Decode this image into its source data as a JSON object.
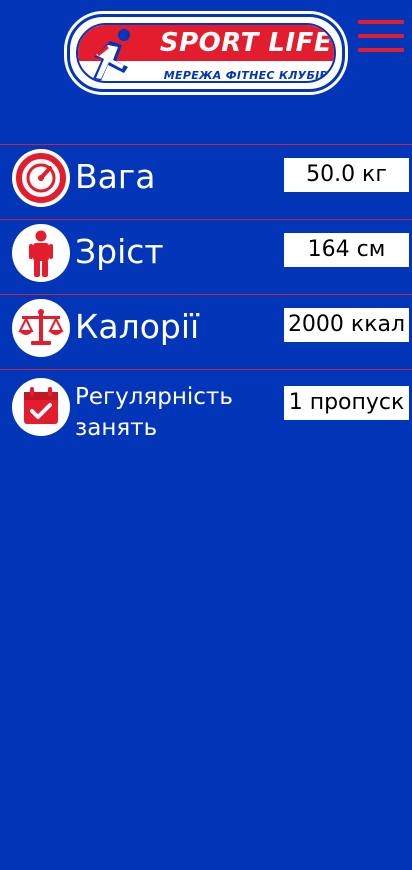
{
  "header": {
    "logo_title": "SPORT LIFE",
    "logo_subtitle": "МЕРЕЖА ФІТНЕС КЛУБІВ",
    "menu_icon": "hamburger-icon"
  },
  "colors": {
    "background": "#0235b8",
    "accent_red": "#e31d2d",
    "divider": "#c7243d"
  },
  "metrics": [
    {
      "label": "Вага",
      "value": "50.0 кг",
      "icon": "speedometer-icon"
    },
    {
      "label": "Зріст",
      "value": "164 см",
      "icon": "person-icon"
    },
    {
      "label": "Калорії",
      "value": "2000 ккал",
      "icon": "scales-icon"
    },
    {
      "label": "Регулярність занять",
      "value": "1 пропуск",
      "icon": "calendar-check-icon"
    }
  ]
}
